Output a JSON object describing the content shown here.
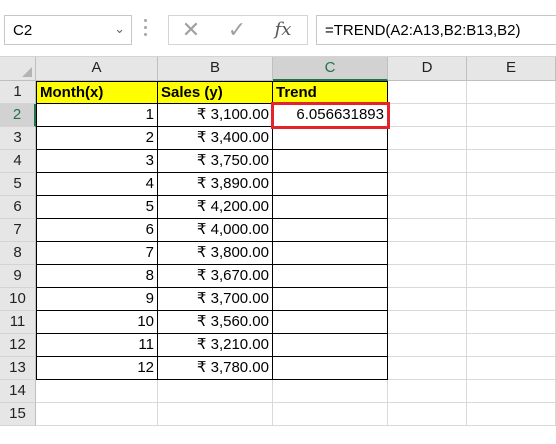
{
  "formula_bar": {
    "name_box": "C2",
    "cancel_glyph": "✕",
    "enter_glyph": "✓",
    "fx_glyph": "fx",
    "formula": "=TREND(A2:A13,B2:B13,B2)"
  },
  "columns": [
    "A",
    "B",
    "C",
    "D",
    "E"
  ],
  "rows": [
    "1",
    "2",
    "3",
    "4",
    "5",
    "6",
    "7",
    "8",
    "9",
    "10",
    "11",
    "12",
    "13",
    "14",
    "15"
  ],
  "selected_cell": "C2",
  "headers": {
    "a": "Month(x)",
    "b": "Sales (y)",
    "c": "Trend"
  },
  "table": [
    {
      "month": "1",
      "sales": "₹ 3,100.00",
      "trend": "6.056631893"
    },
    {
      "month": "2",
      "sales": "₹ 3,400.00",
      "trend": ""
    },
    {
      "month": "3",
      "sales": "₹ 3,750.00",
      "trend": ""
    },
    {
      "month": "4",
      "sales": "₹ 3,890.00",
      "trend": ""
    },
    {
      "month": "5",
      "sales": "₹ 4,200.00",
      "trend": ""
    },
    {
      "month": "6",
      "sales": "₹ 4,000.00",
      "trend": ""
    },
    {
      "month": "7",
      "sales": "₹ 3,800.00",
      "trend": ""
    },
    {
      "month": "8",
      "sales": "₹ 3,670.00",
      "trend": ""
    },
    {
      "month": "9",
      "sales": "₹ 3,700.00",
      "trend": ""
    },
    {
      "month": "10",
      "sales": "₹ 3,560.00",
      "trend": ""
    },
    {
      "month": "11",
      "sales": "₹ 3,210.00",
      "trend": ""
    },
    {
      "month": "12",
      "sales": "₹ 3,780.00",
      "trend": ""
    }
  ],
  "colors": {
    "header_fill": "#ffff00",
    "selection_border": "#e5232b",
    "excel_green": "#217346"
  }
}
